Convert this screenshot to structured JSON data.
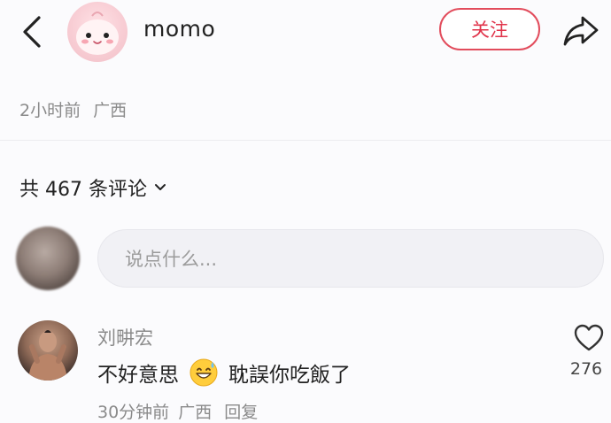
{
  "header": {
    "author_name": "momo",
    "follow_label": "关注",
    "accent_color": "#e0334a"
  },
  "post_meta": {
    "time": "2小时前",
    "location": "广西"
  },
  "comments_section": {
    "count_label": "共 467 条评论"
  },
  "comment_input": {
    "placeholder": "说点什么..."
  },
  "comments": [
    {
      "author": "刘畊宏",
      "text_before_emoji": "不好意思",
      "emoji": "grinning-sweat-emoji",
      "text_after_emoji": "耽誤你吃飯了",
      "time": "30分钟前",
      "location": "广西",
      "reply_label": "回复",
      "likes": "276"
    }
  ],
  "icons": {
    "back": "chevron-left-icon",
    "share": "share-arrow-icon",
    "dropdown": "chevron-down-icon",
    "like": "heart-outline-icon"
  }
}
